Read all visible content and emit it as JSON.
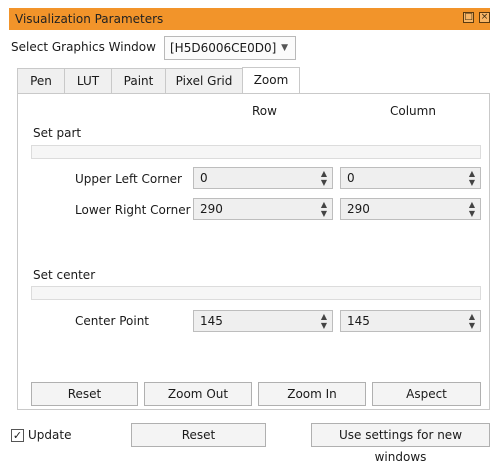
{
  "window": {
    "title": "Visualization Parameters"
  },
  "graphics_window": {
    "label": "Select Graphics Window",
    "value": "[H5D6006CE0D0]"
  },
  "tabs": [
    {
      "label": "Pen"
    },
    {
      "label": "LUT"
    },
    {
      "label": "Paint"
    },
    {
      "label": "Pixel Grid"
    },
    {
      "label": "Zoom"
    }
  ],
  "zoom": {
    "column_headers": {
      "row": "Row",
      "column": "Column"
    },
    "set_part": {
      "label": "Set part",
      "upper_left": {
        "label": "Upper Left Corner",
        "row": "0",
        "column": "0"
      },
      "lower_right": {
        "label": "Lower Right Corner",
        "row": "290",
        "column": "290"
      }
    },
    "set_center": {
      "label": "Set center",
      "center_point": {
        "label": "Center Point",
        "row": "145",
        "column": "145"
      }
    },
    "buttons": {
      "reset": "Reset",
      "zoom_out": "Zoom Out",
      "zoom_in": "Zoom In",
      "aspect": "Aspect"
    }
  },
  "footer": {
    "update_label": "Update",
    "update_checked": true,
    "reset": "Reset",
    "use_settings": "Use settings for new windows"
  }
}
